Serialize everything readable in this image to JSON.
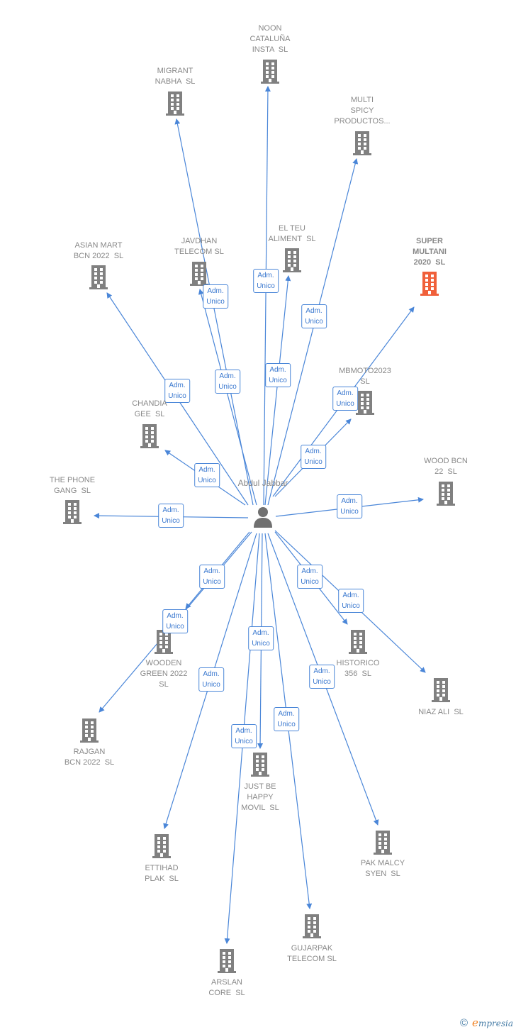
{
  "center": {
    "name": "Abdul\nJabbar",
    "icon": "person-icon"
  },
  "colors": {
    "edge": "#4a86d8",
    "building": "#808080",
    "highlight": "#f0603a"
  },
  "role_label": "Adm.\nUnico",
  "nodes": [
    {
      "name": "NOON\nCATALUÑA\nINSTA  SL",
      "role": "Adm.\nUnico"
    },
    {
      "name": "MIGRANT\nNABHA  SL",
      "role": "Adm.\nUnico"
    },
    {
      "name": "MULTI\nSPICY\nPRODUCTOS...",
      "role": "Adm.\nUnico"
    },
    {
      "name": "ASIAN MART\nBCN 2022  SL",
      "role": "Adm.\nUnico"
    },
    {
      "name": "JAVDHAN\nTELECOM SL",
      "role": "Adm.\nUnico"
    },
    {
      "name": "EL TEU\nALIMENT  SL",
      "role": "Adm.\nUnico"
    },
    {
      "name": "SUPER\nMULTANI\n2020  SL",
      "role": "Adm.\nUnico",
      "highlight": true
    },
    {
      "name": "MBMOTO2023\nSL",
      "role": "Adm.\nUnico"
    },
    {
      "name": "CHANDIA\nGEE  SL",
      "role": "Adm.\nUnico"
    },
    {
      "name": "WOOD BCN\n22  SL",
      "role": "Adm.\nUnico"
    },
    {
      "name": "THE PHONE\nGANG  SL",
      "role": "Adm.\nUnico"
    },
    {
      "name": "WOODEN\nGREEN 2022\nSL",
      "role": "Adm.\nUnico"
    },
    {
      "name": "RAJGAN\nBCN 2022  SL",
      "role": "Adm.\nUnico"
    },
    {
      "name": "HISTORICO\n356  SL",
      "role": "Adm.\nUnico"
    },
    {
      "name": "NIAZ ALI  SL",
      "role": "Adm.\nUnico"
    },
    {
      "name": "JUST BE\nHAPPY\nMOVIL  SL",
      "role": "Adm.\nUnico"
    },
    {
      "name": "ETTIHAD\nPLAK  SL",
      "role": "Adm.\nUnico"
    },
    {
      "name": "PAK MALCY\nSYEN  SL",
      "role": "Adm.\nUnico"
    },
    {
      "name": "GUJARPAK\nTELECOM SL",
      "role": "Adm.\nUnico"
    },
    {
      "name": "ARSLAN\nCORE  SL",
      "role": "Adm.\nUnico"
    }
  ],
  "footer": {
    "copyright": "©",
    "brand_initial": "e",
    "brand_rest": "mpresia"
  }
}
